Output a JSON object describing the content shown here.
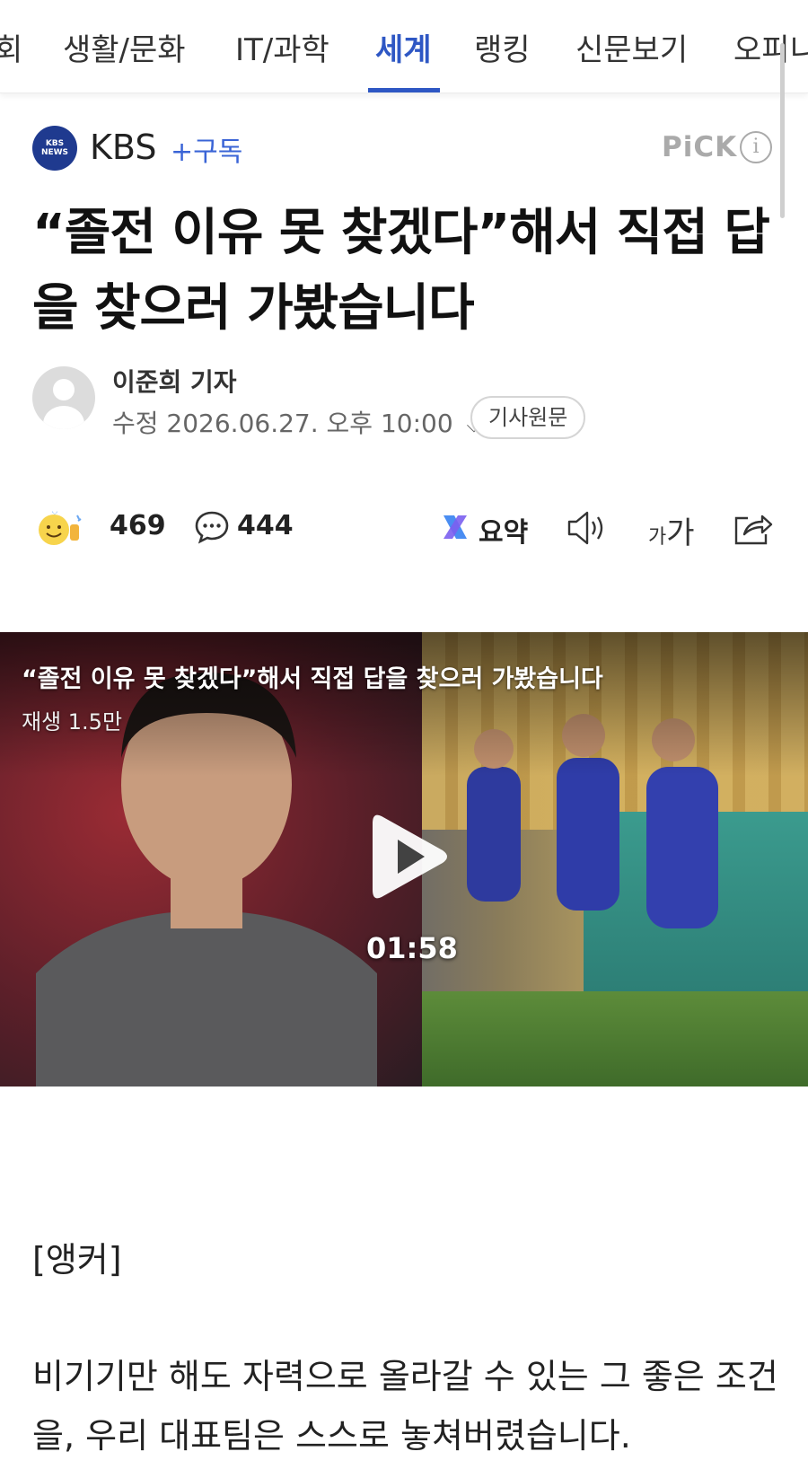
{
  "nav": {
    "tabs": [
      "회",
      "생활/문화",
      "IT/과학",
      "세계",
      "랭킹",
      "신문보기",
      "오피니"
    ],
    "active_tab": "세계",
    "accent_color": "#2e57c4"
  },
  "press": {
    "logo_text": "KBS NEWS",
    "name": "KBS",
    "subscribe_label": "+구독",
    "pick_label": "PiCK",
    "info_icon": "info-icon"
  },
  "article": {
    "headline": "“졸전 이유 못 찾겠다”해서 직접 답을 찾으러 가봤습니다",
    "reporter": "이준희 기자",
    "date": "수정 2026.06.27. 오후 10:00",
    "original_button": "기사원문"
  },
  "actions": {
    "reaction_count": "469",
    "comment_count": "444",
    "summary_label": "요약",
    "font_small": "가",
    "font_large": "가"
  },
  "video": {
    "title": "“졸전 이유 못 찾겠다”해서 직접 답을 찾으러 가봤습니다",
    "views": "재생 1.5만",
    "duration": "01:58"
  },
  "body": {
    "anchor_label": "[앵커]",
    "paragraph": "비기기만 해도 자력으로 올라갈 수 있는 그 좋은 조건을, 우리 대표팀은 스스로 놓쳐버렸습니다."
  }
}
